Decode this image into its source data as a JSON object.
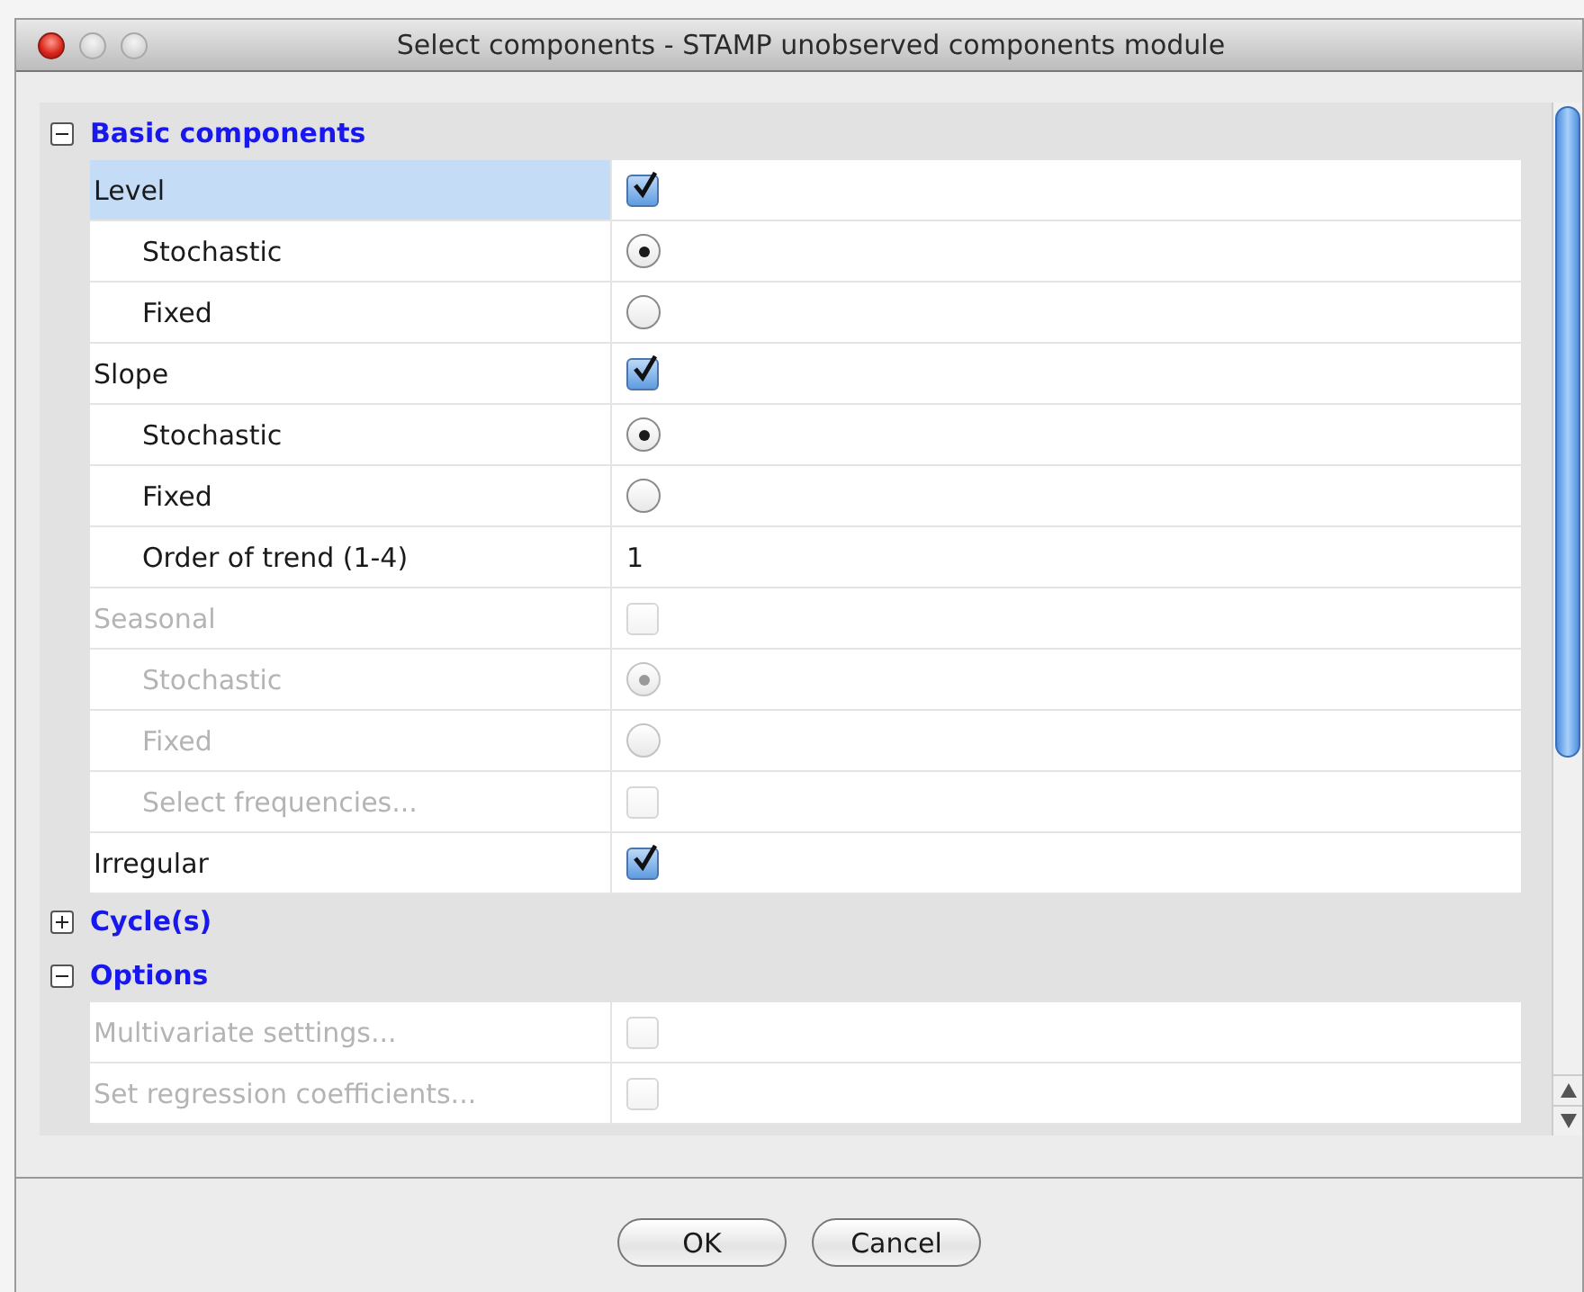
{
  "window": {
    "title": "Select components - STAMP unobserved components module"
  },
  "sections": [
    {
      "title": "Basic components",
      "expanded": true,
      "rows": [
        {
          "label": "Level",
          "selected": true,
          "disabled": false,
          "control": {
            "kind": "checkbox",
            "checked": true
          },
          "children": [
            {
              "label": "Stochastic",
              "selected": false,
              "disabled": false,
              "control": {
                "kind": "radio",
                "selected": true
              }
            },
            {
              "label": "Fixed",
              "selected": false,
              "disabled": false,
              "control": {
                "kind": "radio",
                "selected": false
              }
            }
          ]
        },
        {
          "label": "Slope",
          "selected": false,
          "disabled": false,
          "control": {
            "kind": "checkbox",
            "checked": true
          },
          "children": [
            {
              "label": "Stochastic",
              "selected": false,
              "disabled": false,
              "control": {
                "kind": "radio",
                "selected": true
              }
            },
            {
              "label": "Fixed",
              "selected": false,
              "disabled": false,
              "control": {
                "kind": "radio",
                "selected": false
              }
            },
            {
              "label": "Order of trend (1-4)",
              "selected": false,
              "disabled": false,
              "control": {
                "kind": "number",
                "value": "1"
              }
            }
          ]
        },
        {
          "label": "Seasonal",
          "selected": false,
          "disabled": true,
          "control": {
            "kind": "checkbox",
            "checked": false
          },
          "children": [
            {
              "label": "Stochastic",
              "selected": false,
              "disabled": true,
              "control": {
                "kind": "radio",
                "selected": true
              }
            },
            {
              "label": "Fixed",
              "selected": false,
              "disabled": true,
              "control": {
                "kind": "radio",
                "selected": false
              }
            },
            {
              "label": "Select frequencies...",
              "selected": false,
              "disabled": true,
              "control": {
                "kind": "checkbox",
                "checked": false
              }
            }
          ]
        },
        {
          "label": "Irregular",
          "selected": false,
          "disabled": false,
          "control": {
            "kind": "checkbox",
            "checked": true
          }
        }
      ]
    },
    {
      "title": "Cycle(s)",
      "expanded": false
    },
    {
      "title": "Options",
      "expanded": true,
      "rows": [
        {
          "label": "Multivariate settings...",
          "selected": false,
          "disabled": true,
          "control": {
            "kind": "checkbox",
            "checked": false
          }
        },
        {
          "label": "Set regression coefficients...",
          "selected": false,
          "disabled": true,
          "control": {
            "kind": "checkbox",
            "checked": false
          }
        }
      ]
    }
  ],
  "buttons": [
    "OK",
    "Cancel"
  ]
}
